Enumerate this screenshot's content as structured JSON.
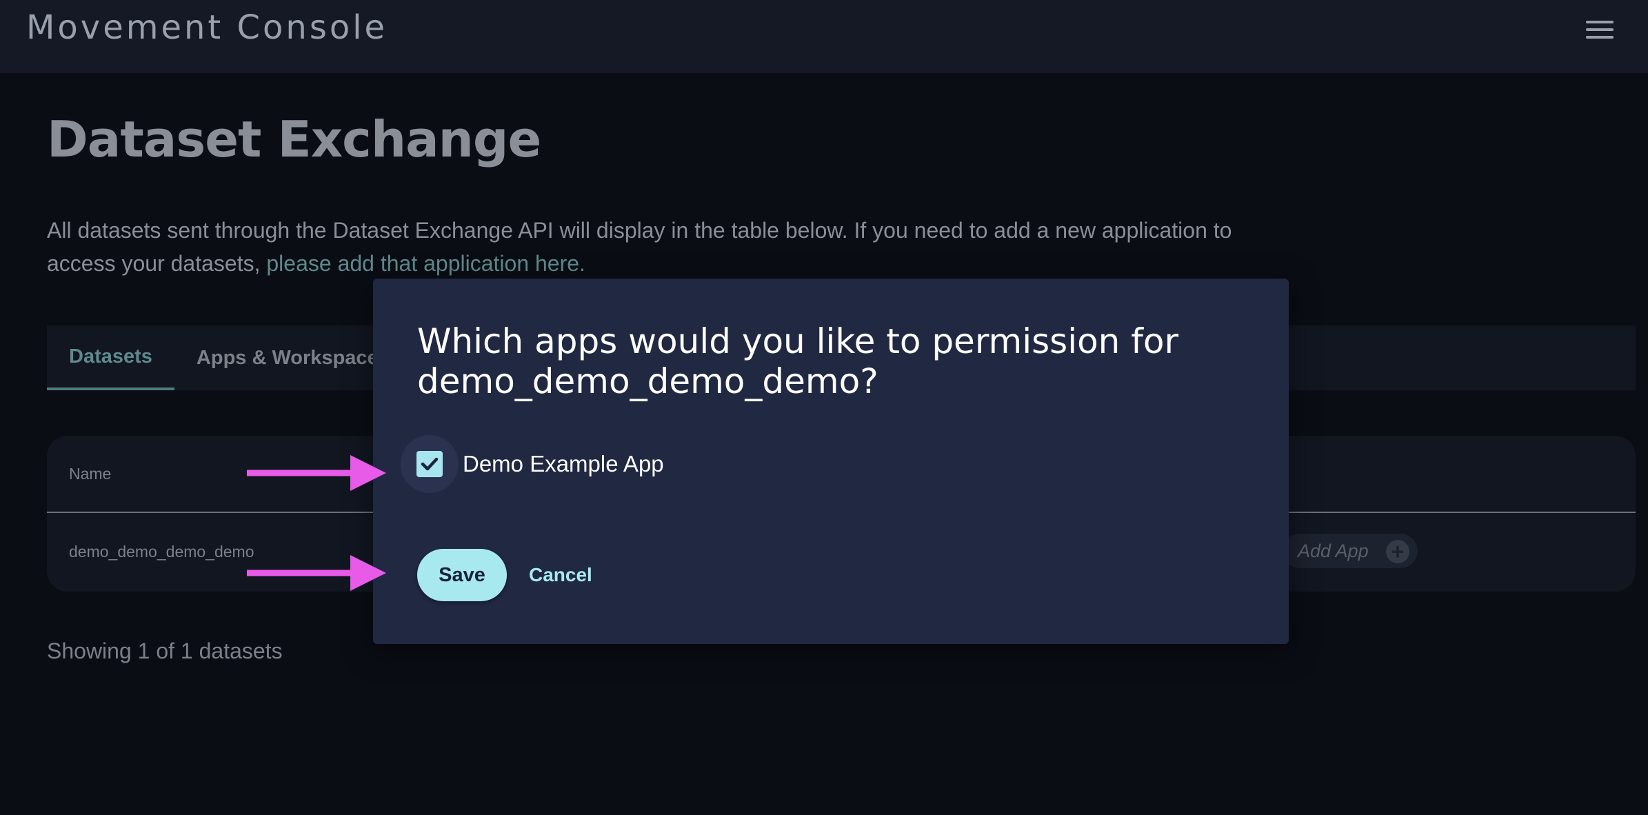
{
  "app": {
    "title": "Movement Console",
    "menu_icon": "hamburger-menu-icon"
  },
  "page": {
    "title": "Dataset Exchange",
    "intro_text": "All datasets sent through the Dataset Exchange API will display in the table below. If you need to add a new application to access your datasets,",
    "intro_link": "please add that application here."
  },
  "tabs": [
    {
      "label": "Datasets",
      "active": true
    },
    {
      "label": "Apps & Workspace",
      "active": false
    }
  ],
  "table": {
    "header_name": "Name",
    "rows": [
      {
        "name": "demo_demo_demo_demo",
        "add_app_label": "Add App",
        "add_icon": "plus-circle-icon"
      }
    ],
    "footer": "Showing 1 of 1 datasets"
  },
  "modal": {
    "title": "Which apps would you like to permission for demo_demo_demo_demo?",
    "options": [
      {
        "label": "Demo Example App",
        "checked": true
      }
    ],
    "save_label": "Save",
    "cancel_label": "Cancel"
  },
  "colors": {
    "accent": "#a8e9f0",
    "modal_bg": "#212842",
    "annotation_arrow": "#e85ae8"
  }
}
